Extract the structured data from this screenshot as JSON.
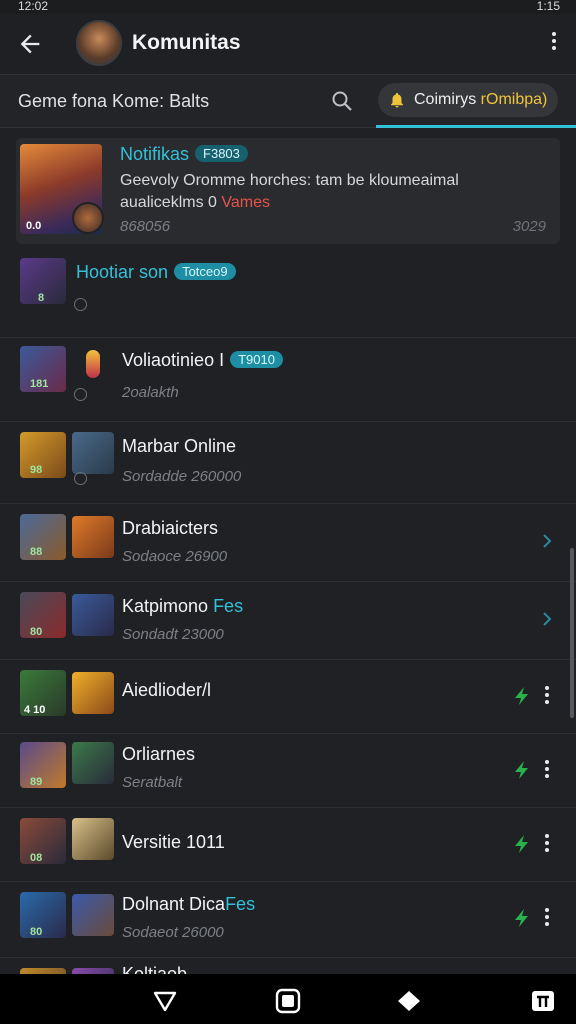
{
  "status": {
    "time": "12:02",
    "right": "1:15"
  },
  "app": {
    "title": "Komunitas"
  },
  "search": {
    "text": "Geme fona Kome: Balts",
    "chip_label": "Coimirys ",
    "chip_accent": "rOmibpa)"
  },
  "featured": {
    "title": "Notifikas",
    "tag": "F3803",
    "line1": "Geevoly Oromme horches: tam be kloumeaimal",
    "line2a": "aualiceklms 0 ",
    "line2b": "Vames",
    "sub": "868056",
    "count": "3029",
    "thumb_label": "0.0"
  },
  "rows": [
    {
      "title": "Hootiar son",
      "tag": "Totceo9",
      "sub": "",
      "badge": "8",
      "accent": true
    },
    {
      "title": "Voliaotinieo I",
      "tag": "T9010",
      "sub": "2oalakth",
      "badge": "181"
    },
    {
      "title": "Marbar Online",
      "tag": "",
      "sub": "Sordadde 260000",
      "badge": "98"
    },
    {
      "title": "Drabiaicters",
      "tag": "",
      "sub": "Sodaoce 26900",
      "badge": "88"
    },
    {
      "title": "Katpimono",
      "title_accent": " Fes",
      "tag": "",
      "sub": "Sondadt 23000",
      "badge": "80"
    },
    {
      "title": "Aiedlioder/l",
      "tag": "",
      "sub": "",
      "badge": "4 10"
    },
    {
      "title": "Orliarnes",
      "tag": "",
      "sub": "Seratbalt",
      "badge": "89"
    },
    {
      "title": "Versitie 1011",
      "tag": "",
      "sub": "",
      "badge": "08"
    },
    {
      "title": "Dolnant Dica",
      "title_accent": "Fes",
      "tag": "",
      "sub": "Sodaeot 26000",
      "badge": "80"
    },
    {
      "title": "Koltiaob",
      "tag": "",
      "sub": "",
      "badge": ""
    }
  ],
  "icons": {
    "back": "arrow-left-icon",
    "menu": "more-vert-icon",
    "search": "search-icon",
    "bell": "bell-icon",
    "chevron": "chevron-right-icon",
    "bolt": "bolt-icon"
  },
  "colors": {
    "accent": "#33c1d9",
    "bolt": "#28b24a",
    "chip_accent": "#f0c43a",
    "bg": "#202124"
  }
}
